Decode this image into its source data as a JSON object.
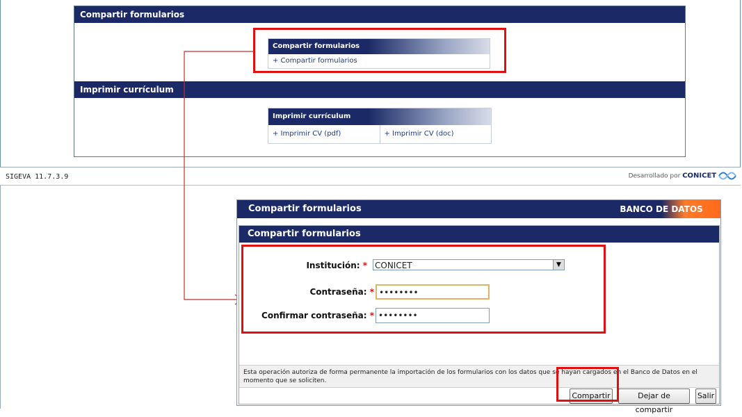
{
  "top_panel": {
    "share_section_title": "Compartir formularios",
    "share_box_title": "Compartir formularios",
    "share_link": "+ Compartir formularios",
    "print_section_title": "Imprimir currículum",
    "print_box_title": "Imprimir currículum",
    "print_pdf_link": "+ Imprimir CV (pdf)",
    "print_doc_link": "+ Imprimir CV (doc)"
  },
  "footer": {
    "version": "SIGEVA 11.7.3.9",
    "developed_by_prefix": "Desarrollado por",
    "developed_by_org": "CONICET"
  },
  "form_window": {
    "title": "Compartir formularios",
    "banner": "BANCO DE DATOS",
    "panel_title": "Compartir formularios",
    "institution_label": "Institución:",
    "institution_value": "CONICET",
    "password_label": "Contraseña:",
    "password_value": "••••••••",
    "confirm_label": "Confirmar contraseña:",
    "confirm_value": "••••••••",
    "required_mark": "*",
    "note": "Esta operación autoriza de forma permanente la importación de los formularios con los datos que se hayan cargados en el Banco de Datos en el momento que se soliciten.",
    "share_button": "Compartir",
    "unshare_button": "Dejar de compartir",
    "exit_button": "Salir"
  },
  "colors": {
    "header_navy": "#1b2a66",
    "highlight_red": "#e01010",
    "banner_orange": "#ff6a1a",
    "link_blue": "#1e3a8a"
  }
}
